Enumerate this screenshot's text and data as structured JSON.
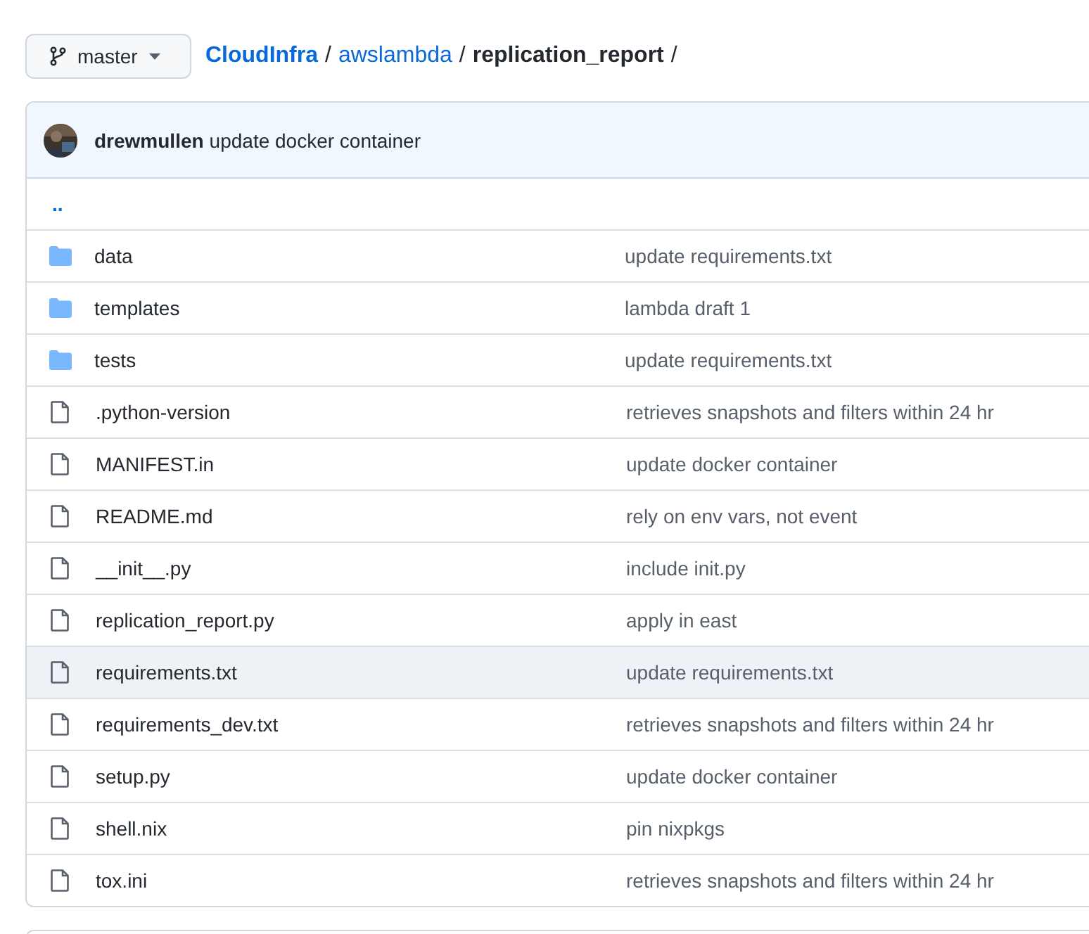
{
  "branch": {
    "label": "master"
  },
  "breadcrumb": [
    {
      "label": "CloudInfra",
      "kind": "link"
    },
    {
      "label": "awslambda",
      "kind": "link"
    },
    {
      "label": "replication_report",
      "kind": "current"
    }
  ],
  "breadcrumb_separator": "/",
  "latest_commit": {
    "author": "drewmullen",
    "message": "update docker container"
  },
  "parent_link": "..",
  "files": [
    {
      "name": "data",
      "kind": "folder",
      "commit": "update requirements.txt",
      "hovered": false
    },
    {
      "name": "templates",
      "kind": "folder",
      "commit": "lambda draft 1",
      "hovered": false
    },
    {
      "name": "tests",
      "kind": "folder",
      "commit": "update requirements.txt",
      "hovered": false
    },
    {
      "name": ".python-version",
      "kind": "file",
      "commit": "retrieves snapshots and filters within 24 hr",
      "hovered": false
    },
    {
      "name": "MANIFEST.in",
      "kind": "file",
      "commit": "update docker container",
      "hovered": false
    },
    {
      "name": "README.md",
      "kind": "file",
      "commit": "rely on env vars, not event",
      "hovered": false
    },
    {
      "name": "__init__.py",
      "kind": "file",
      "commit": "include init.py",
      "hovered": false
    },
    {
      "name": "replication_report.py",
      "kind": "file",
      "commit": "apply in east",
      "hovered": false
    },
    {
      "name": "requirements.txt",
      "kind": "file",
      "commit": "update requirements.txt",
      "hovered": true
    },
    {
      "name": "requirements_dev.txt",
      "kind": "file",
      "commit": "retrieves snapshots and filters within 24 hr",
      "hovered": false
    },
    {
      "name": "setup.py",
      "kind": "file",
      "commit": "update docker container",
      "hovered": false
    },
    {
      "name": "shell.nix",
      "kind": "file",
      "commit": "pin nixpkgs",
      "hovered": false
    },
    {
      "name": "tox.ini",
      "kind": "file",
      "commit": "retrieves snapshots and filters within 24 hr",
      "hovered": false
    }
  ]
}
